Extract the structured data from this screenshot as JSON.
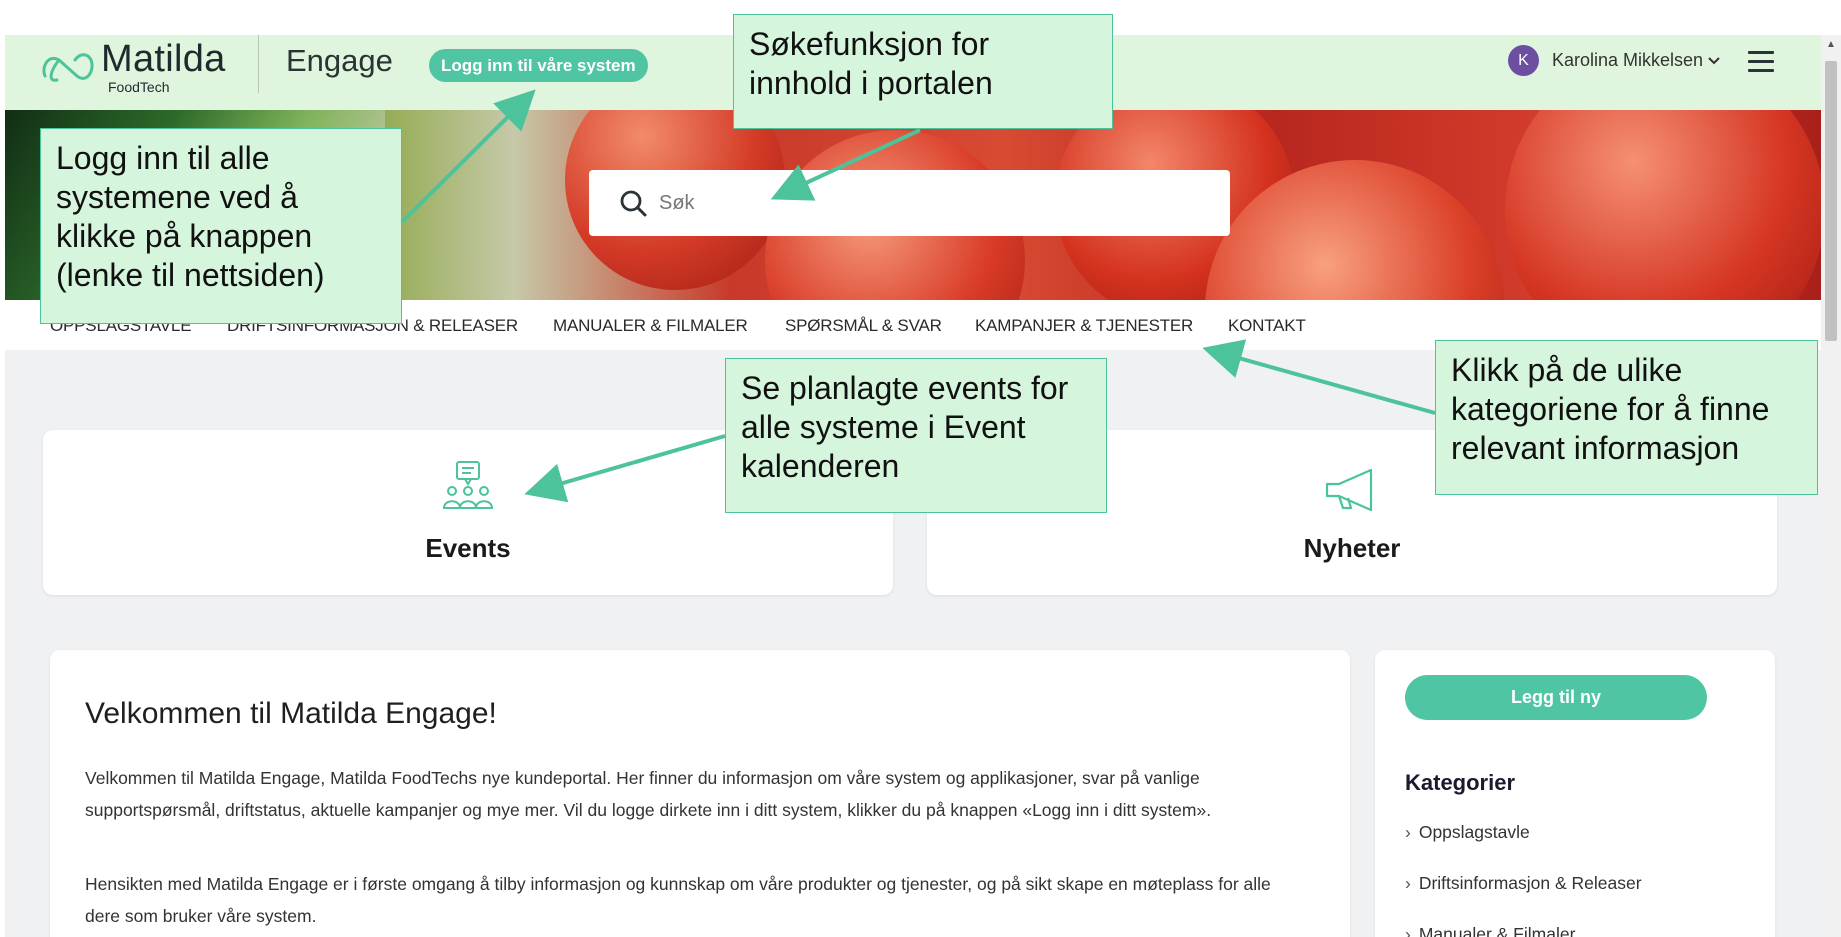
{
  "header": {
    "logo_main": "Matilda",
    "logo_sub": "FoodTech",
    "product": "Engage",
    "login_button": "Logg inn til våre system",
    "user_initial": "K",
    "user_name": "Karolina Mikkelsen"
  },
  "search": {
    "placeholder": "Søk"
  },
  "nav": {
    "items": [
      "OPPSLAGSTAVLE",
      "DRIFTSINFORMASJON & RELEASER",
      "MANUALER & FILMALER",
      "SPØRSMÅL & SVAR",
      "KAMPANJER & TJENESTER",
      "KONTAKT"
    ]
  },
  "cards": {
    "events": "Events",
    "news": "Nyheter"
  },
  "welcome": {
    "title": "Velkommen til Matilda Engage!",
    "p1": "Velkommen til Matilda Engage, Matilda FoodTechs nye kundeportal. Her finner du informasjon om våre system og applikasjoner, svar på vanlige supportspørsmål, driftstatus, aktuelle kampanjer og mye mer. Vil du logge dirkete inn i ditt system, klikker du på knappen «Logg inn i ditt system».",
    "p2": "Hensikten med Matilda Engage er i første omgang å tilby informasjon og kunnskap om våre produkter og tjenester, og på sikt skape en møteplass for alle dere som bruker våre system."
  },
  "sidebar": {
    "add_button": "Legg til ny",
    "categories_heading": "Kategorier",
    "categories": [
      "Oppslagstavle",
      "Driftsinformasjon & Releaser",
      "Manualer & Filmaler"
    ]
  },
  "annotations": {
    "login": "Logg inn til alle systemene  ved å klikke på knappen (lenke til nettsiden)",
    "search": "Søkefunksjon for innhold i portalen",
    "events": "Se planlagte events for alle systeme i Event kalenderen",
    "categories": "Klikk på de ulike kategoriene for å finne relevant informasjon"
  },
  "colors": {
    "accent": "#50c5a3",
    "header_bg": "#dff5dd",
    "note_bg": "#d6f5dd",
    "note_border": "#4cc39a",
    "avatar": "#6c4fa0"
  }
}
